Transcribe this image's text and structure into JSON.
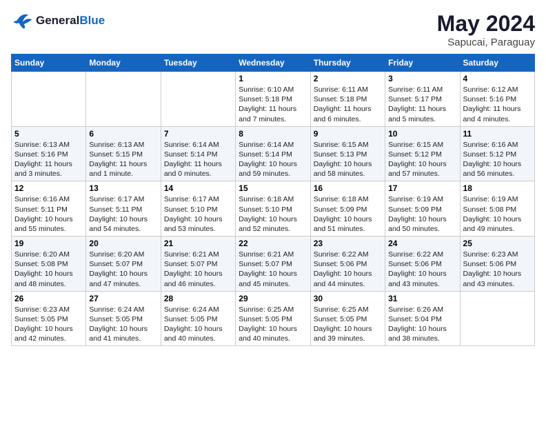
{
  "header": {
    "logo_line1": "General",
    "logo_line2": "Blue",
    "month_year": "May 2024",
    "location": "Sapucai, Paraguay"
  },
  "weekdays": [
    "Sunday",
    "Monday",
    "Tuesday",
    "Wednesday",
    "Thursday",
    "Friday",
    "Saturday"
  ],
  "weeks": [
    [
      {
        "day": "",
        "info": ""
      },
      {
        "day": "",
        "info": ""
      },
      {
        "day": "",
        "info": ""
      },
      {
        "day": "1",
        "info": "Sunrise: 6:10 AM\nSunset: 5:18 PM\nDaylight: 11 hours\nand 7 minutes."
      },
      {
        "day": "2",
        "info": "Sunrise: 6:11 AM\nSunset: 5:18 PM\nDaylight: 11 hours\nand 6 minutes."
      },
      {
        "day": "3",
        "info": "Sunrise: 6:11 AM\nSunset: 5:17 PM\nDaylight: 11 hours\nand 5 minutes."
      },
      {
        "day": "4",
        "info": "Sunrise: 6:12 AM\nSunset: 5:16 PM\nDaylight: 11 hours\nand 4 minutes."
      }
    ],
    [
      {
        "day": "5",
        "info": "Sunrise: 6:13 AM\nSunset: 5:16 PM\nDaylight: 11 hours\nand 3 minutes."
      },
      {
        "day": "6",
        "info": "Sunrise: 6:13 AM\nSunset: 5:15 PM\nDaylight: 11 hours\nand 1 minute."
      },
      {
        "day": "7",
        "info": "Sunrise: 6:14 AM\nSunset: 5:14 PM\nDaylight: 11 hours\nand 0 minutes."
      },
      {
        "day": "8",
        "info": "Sunrise: 6:14 AM\nSunset: 5:14 PM\nDaylight: 10 hours\nand 59 minutes."
      },
      {
        "day": "9",
        "info": "Sunrise: 6:15 AM\nSunset: 5:13 PM\nDaylight: 10 hours\nand 58 minutes."
      },
      {
        "day": "10",
        "info": "Sunrise: 6:15 AM\nSunset: 5:12 PM\nDaylight: 10 hours\nand 57 minutes."
      },
      {
        "day": "11",
        "info": "Sunrise: 6:16 AM\nSunset: 5:12 PM\nDaylight: 10 hours\nand 56 minutes."
      }
    ],
    [
      {
        "day": "12",
        "info": "Sunrise: 6:16 AM\nSunset: 5:11 PM\nDaylight: 10 hours\nand 55 minutes."
      },
      {
        "day": "13",
        "info": "Sunrise: 6:17 AM\nSunset: 5:11 PM\nDaylight: 10 hours\nand 54 minutes."
      },
      {
        "day": "14",
        "info": "Sunrise: 6:17 AM\nSunset: 5:10 PM\nDaylight: 10 hours\nand 53 minutes."
      },
      {
        "day": "15",
        "info": "Sunrise: 6:18 AM\nSunset: 5:10 PM\nDaylight: 10 hours\nand 52 minutes."
      },
      {
        "day": "16",
        "info": "Sunrise: 6:18 AM\nSunset: 5:09 PM\nDaylight: 10 hours\nand 51 minutes."
      },
      {
        "day": "17",
        "info": "Sunrise: 6:19 AM\nSunset: 5:09 PM\nDaylight: 10 hours\nand 50 minutes."
      },
      {
        "day": "18",
        "info": "Sunrise: 6:19 AM\nSunset: 5:08 PM\nDaylight: 10 hours\nand 49 minutes."
      }
    ],
    [
      {
        "day": "19",
        "info": "Sunrise: 6:20 AM\nSunset: 5:08 PM\nDaylight: 10 hours\nand 48 minutes."
      },
      {
        "day": "20",
        "info": "Sunrise: 6:20 AM\nSunset: 5:07 PM\nDaylight: 10 hours\nand 47 minutes."
      },
      {
        "day": "21",
        "info": "Sunrise: 6:21 AM\nSunset: 5:07 PM\nDaylight: 10 hours\nand 46 minutes."
      },
      {
        "day": "22",
        "info": "Sunrise: 6:21 AM\nSunset: 5:07 PM\nDaylight: 10 hours\nand 45 minutes."
      },
      {
        "day": "23",
        "info": "Sunrise: 6:22 AM\nSunset: 5:06 PM\nDaylight: 10 hours\nand 44 minutes."
      },
      {
        "day": "24",
        "info": "Sunrise: 6:22 AM\nSunset: 5:06 PM\nDaylight: 10 hours\nand 43 minutes."
      },
      {
        "day": "25",
        "info": "Sunrise: 6:23 AM\nSunset: 5:06 PM\nDaylight: 10 hours\nand 43 minutes."
      }
    ],
    [
      {
        "day": "26",
        "info": "Sunrise: 6:23 AM\nSunset: 5:05 PM\nDaylight: 10 hours\nand 42 minutes."
      },
      {
        "day": "27",
        "info": "Sunrise: 6:24 AM\nSunset: 5:05 PM\nDaylight: 10 hours\nand 41 minutes."
      },
      {
        "day": "28",
        "info": "Sunrise: 6:24 AM\nSunset: 5:05 PM\nDaylight: 10 hours\nand 40 minutes."
      },
      {
        "day": "29",
        "info": "Sunrise: 6:25 AM\nSunset: 5:05 PM\nDaylight: 10 hours\nand 40 minutes."
      },
      {
        "day": "30",
        "info": "Sunrise: 6:25 AM\nSunset: 5:05 PM\nDaylight: 10 hours\nand 39 minutes."
      },
      {
        "day": "31",
        "info": "Sunrise: 6:26 AM\nSunset: 5:04 PM\nDaylight: 10 hours\nand 38 minutes."
      },
      {
        "day": "",
        "info": ""
      }
    ]
  ]
}
